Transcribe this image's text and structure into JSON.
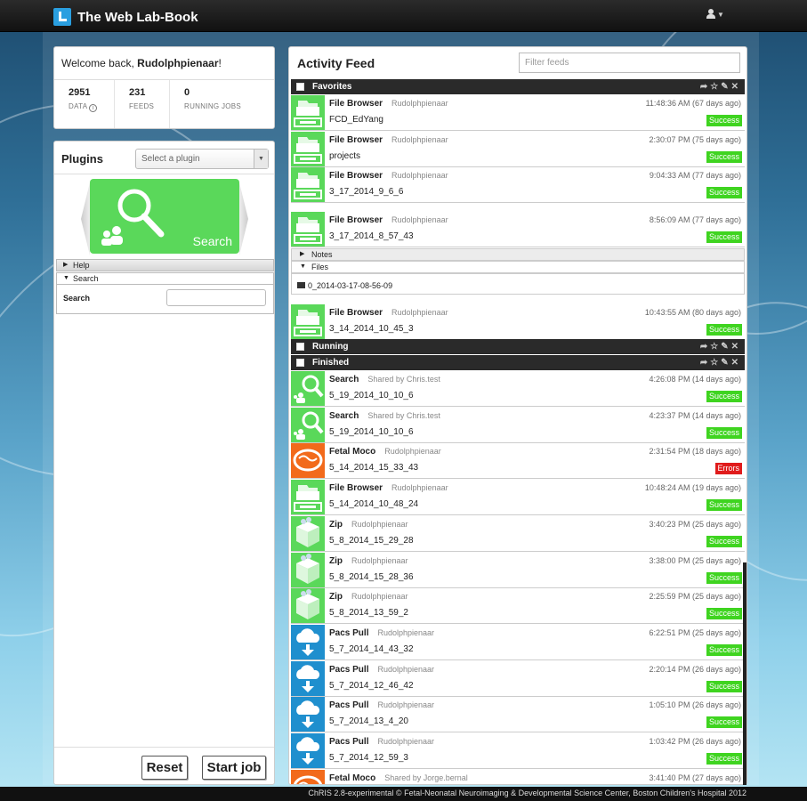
{
  "app": {
    "title": "The Web Lab-Book"
  },
  "welcome": {
    "prefix": "Welcome back, ",
    "user": "Rudolphpienaar",
    "suffix": "!"
  },
  "stats": [
    {
      "value": "2951",
      "label": "DATA"
    },
    {
      "value": "231",
      "label": "FEEDS"
    },
    {
      "value": "0",
      "label": "RUNNING JOBS"
    }
  ],
  "plugins": {
    "title": "Plugins",
    "select_placeholder": "Select a plugin",
    "tile_label": "Search",
    "help_label": "Help",
    "search_label": "Search",
    "search_field_label": "Search",
    "reset_label": "Reset",
    "start_label": "Start job"
  },
  "feed": {
    "title": "Activity Feed",
    "filter_placeholder": "Filter feeds",
    "groups": {
      "favorites": "Favorites",
      "running": "Running",
      "finished": "Finished"
    },
    "notes_label": "Notes",
    "files_label": "Files",
    "file_name": "0_2014-03-17-08-56-09",
    "favorites": [
      {
        "name": "File Browser",
        "owner": "Rudolphpienaar",
        "date": "11:48:36 AM (67 days ago)",
        "job": "FCD_EdYang",
        "status": "Success",
        "icon": "folder-icon"
      },
      {
        "name": "File Browser",
        "owner": "Rudolphpienaar",
        "date": "2:30:07 PM (75 days ago)",
        "job": "projects",
        "status": "Success",
        "icon": "folder-icon"
      },
      {
        "name": "File Browser",
        "owner": "Rudolphpienaar",
        "date": "9:04:33 AM (77 days ago)",
        "job": "3_17_2014_9_6_6",
        "status": "Success",
        "icon": "folder-icon"
      },
      {
        "name": "File Browser",
        "owner": "Rudolphpienaar",
        "date": "8:56:09 AM (77 days ago)",
        "job": "3_17_2014_8_57_43",
        "status": "Success",
        "icon": "folder-icon"
      },
      {
        "name": "File Browser",
        "owner": "Rudolphpienaar",
        "date": "10:43:55 AM (80 days ago)",
        "job": "3_14_2014_10_45_3",
        "status": "Success",
        "icon": "folder-icon"
      }
    ],
    "finished": [
      {
        "name": "Search",
        "owner": "Shared by Chris.test",
        "date": "4:26:08 PM (14 days ago)",
        "job": "5_19_2014_10_10_6",
        "status": "Success",
        "color": "green",
        "icon": "search-icon"
      },
      {
        "name": "Search",
        "owner": "Shared by Chris.test",
        "date": "4:23:37 PM (14 days ago)",
        "job": "5_19_2014_10_10_6",
        "status": "Success",
        "color": "green",
        "icon": "search-icon"
      },
      {
        "name": "Fetal Moco",
        "owner": "Rudolphpienaar",
        "date": "2:31:54 PM (18 days ago)",
        "job": "5_14_2014_15_33_43",
        "status": "Errors",
        "color": "orange",
        "icon": "brain-icon"
      },
      {
        "name": "File Browser",
        "owner": "Rudolphpienaar",
        "date": "10:48:24 AM (19 days ago)",
        "job": "5_14_2014_10_48_24",
        "status": "Success",
        "color": "green",
        "icon": "folder-icon"
      },
      {
        "name": "Zip",
        "owner": "Rudolphpienaar",
        "date": "3:40:23 PM (25 days ago)",
        "job": "5_8_2014_15_29_28",
        "status": "Success",
        "color": "green",
        "icon": "box-icon"
      },
      {
        "name": "Zip",
        "owner": "Rudolphpienaar",
        "date": "3:38:00 PM (25 days ago)",
        "job": "5_8_2014_15_28_36",
        "status": "Success",
        "color": "green",
        "icon": "box-icon"
      },
      {
        "name": "Zip",
        "owner": "Rudolphpienaar",
        "date": "2:25:59 PM (25 days ago)",
        "job": "5_8_2014_13_59_2",
        "status": "Success",
        "color": "green",
        "icon": "box-icon"
      },
      {
        "name": "Pacs Pull",
        "owner": "Rudolphpienaar",
        "date": "6:22:51 PM (25 days ago)",
        "job": "5_7_2014_14_43_32",
        "status": "Success",
        "color": "blue",
        "icon": "cloud-download-icon"
      },
      {
        "name": "Pacs Pull",
        "owner": "Rudolphpienaar",
        "date": "2:20:14 PM (26 days ago)",
        "job": "5_7_2014_12_46_42",
        "status": "Success",
        "color": "blue",
        "icon": "cloud-download-icon"
      },
      {
        "name": "Pacs Pull",
        "owner": "Rudolphpienaar",
        "date": "1:05:10 PM (26 days ago)",
        "job": "5_7_2014_13_4_20",
        "status": "Success",
        "color": "blue",
        "icon": "cloud-download-icon"
      },
      {
        "name": "Pacs Pull",
        "owner": "Rudolphpienaar",
        "date": "1:03:42 PM (26 days ago)",
        "job": "5_7_2014_12_59_3",
        "status": "Success",
        "color": "blue",
        "icon": "cloud-download-icon"
      },
      {
        "name": "Fetal Moco",
        "owner": "Shared by Jorge.bernal",
        "date": "3:41:40 PM (27 days ago)",
        "job": "",
        "status": "",
        "color": "orange",
        "icon": "brain-icon"
      }
    ]
  },
  "footer": {
    "text": "ChRIS 2.8-experimental © Fetal-Neonatal Neuroimaging & Developmental Science Center, Boston Children's Hospital 2012"
  }
}
